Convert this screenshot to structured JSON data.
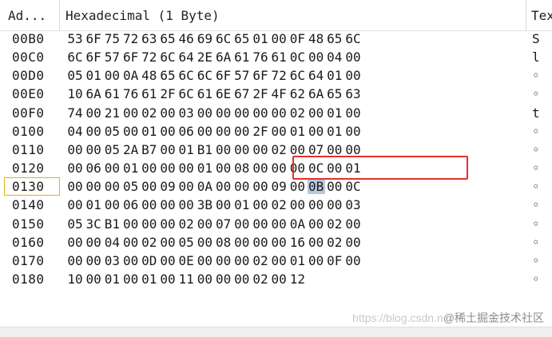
{
  "header": {
    "address": "Ad...",
    "hex": "Hexadecimal (1 Byte)",
    "text": "Tex"
  },
  "selected": {
    "row": 8,
    "col": 8
  },
  "current_row": 8,
  "rows": [
    {
      "address": "00B0",
      "bytes": [
        "53",
        "6F",
        "75",
        "72",
        "63",
        "65",
        "46",
        "69",
        "6C",
        "65",
        "01",
        "00",
        "0F",
        "48",
        "65",
        "6C"
      ],
      "text": "S"
    },
    {
      "address": "00C0",
      "bytes": [
        "6C",
        "6F",
        "57",
        "6F",
        "72",
        "6C",
        "64",
        "2E",
        "6A",
        "61",
        "76",
        "61",
        "0C",
        "00",
        "04",
        "00"
      ],
      "text": "l"
    },
    {
      "address": "00D0",
      "bytes": [
        "05",
        "01",
        "00",
        "0A",
        "48",
        "65",
        "6C",
        "6C",
        "6F",
        "57",
        "6F",
        "72",
        "6C",
        "64",
        "01",
        "00"
      ],
      "text": "◦"
    },
    {
      "address": "00E0",
      "bytes": [
        "10",
        "6A",
        "61",
        "76",
        "61",
        "2F",
        "6C",
        "61",
        "6E",
        "67",
        "2F",
        "4F",
        "62",
        "6A",
        "65",
        "63"
      ],
      "text": "◦"
    },
    {
      "address": "00F0",
      "bytes": [
        "74",
        "00",
        "21",
        "00",
        "02",
        "00",
        "03",
        "00",
        "00",
        "00",
        "00",
        "00",
        "02",
        "00",
        "01",
        "00"
      ],
      "text": "t"
    },
    {
      "address": "0100",
      "bytes": [
        "04",
        "00",
        "05",
        "00",
        "01",
        "00",
        "06",
        "00",
        "00",
        "00",
        "2F",
        "00",
        "01",
        "00",
        "01",
        "00"
      ],
      "text": "◦"
    },
    {
      "address": "0110",
      "bytes": [
        "00",
        "00",
        "05",
        "2A",
        "B7",
        "00",
        "01",
        "B1",
        "00",
        "00",
        "00",
        "02",
        "00",
        "07",
        "00",
        "00"
      ],
      "text": "◦"
    },
    {
      "address": "0120",
      "bytes": [
        "00",
        "06",
        "00",
        "01",
        "00",
        "00",
        "00",
        "01",
        "00",
        "08",
        "00",
        "00",
        "00",
        "0C",
        "00",
        "01"
      ],
      "text": "◦"
    },
    {
      "address": "0130",
      "bytes": [
        "00",
        "00",
        "00",
        "05",
        "00",
        "09",
        "00",
        "0A",
        "00",
        "00",
        "00",
        "09",
        "00",
        "0B",
        "00",
        "0C"
      ],
      "text": "◦"
    },
    {
      "address": "0140",
      "bytes": [
        "00",
        "01",
        "00",
        "06",
        "00",
        "00",
        "00",
        "3B",
        "00",
        "01",
        "00",
        "02",
        "00",
        "00",
        "00",
        "03"
      ],
      "text": "◦"
    },
    {
      "address": "0150",
      "bytes": [
        "05",
        "3C",
        "B1",
        "00",
        "00",
        "00",
        "02",
        "00",
        "07",
        "00",
        "00",
        "00",
        "0A",
        "00",
        "02",
        "00"
      ],
      "text": "◦"
    },
    {
      "address": "0160",
      "bytes": [
        "00",
        "00",
        "04",
        "00",
        "02",
        "00",
        "05",
        "00",
        "08",
        "00",
        "00",
        "00",
        "16",
        "00",
        "02",
        "00"
      ],
      "text": "◦"
    },
    {
      "address": "0170",
      "bytes": [
        "00",
        "00",
        "03",
        "00",
        "0D",
        "00",
        "0E",
        "00",
        "00",
        "00",
        "02",
        "00",
        "01",
        "00",
        "0F",
        "00"
      ],
      "text": "◦"
    },
    {
      "address": "0180",
      "bytes": [
        "10",
        "00",
        "01",
        "00",
        "01",
        "00",
        "11",
        "00",
        "00",
        "00",
        "02",
        "00",
        "12"
      ],
      "text": "◦"
    }
  ],
  "watermark": {
    "prefix": "https://blog.csdn.n",
    "brand": "@稀土掘金技术社区"
  },
  "colors": {
    "highlight_box": "#e0322c",
    "selection": "#b8c8dc",
    "current_row_border": "#e8b200"
  }
}
